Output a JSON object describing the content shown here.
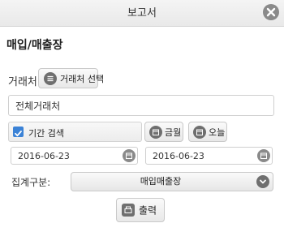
{
  "window": {
    "title": "보고서"
  },
  "heading": "매입/매출장",
  "vendor": {
    "label": "거래처",
    "select_button": "거래처 선택",
    "value": "전체거래처"
  },
  "period": {
    "checkbox_label": "기간 검색",
    "checked": true,
    "this_month_button": "금월",
    "today_button": "오늘",
    "start_date": "2016-06-23",
    "end_date": "2016-06-23"
  },
  "category": {
    "label": "집계구분:",
    "selected": "매입매출장"
  },
  "print_button": "출력",
  "icons": [
    "close-icon",
    "list-icon",
    "calendar-icon",
    "chevron-down-icon",
    "print-icon"
  ],
  "colors": {
    "checkbox_accent": "#3b82d6",
    "icon_gray": "#6f6f6f"
  }
}
